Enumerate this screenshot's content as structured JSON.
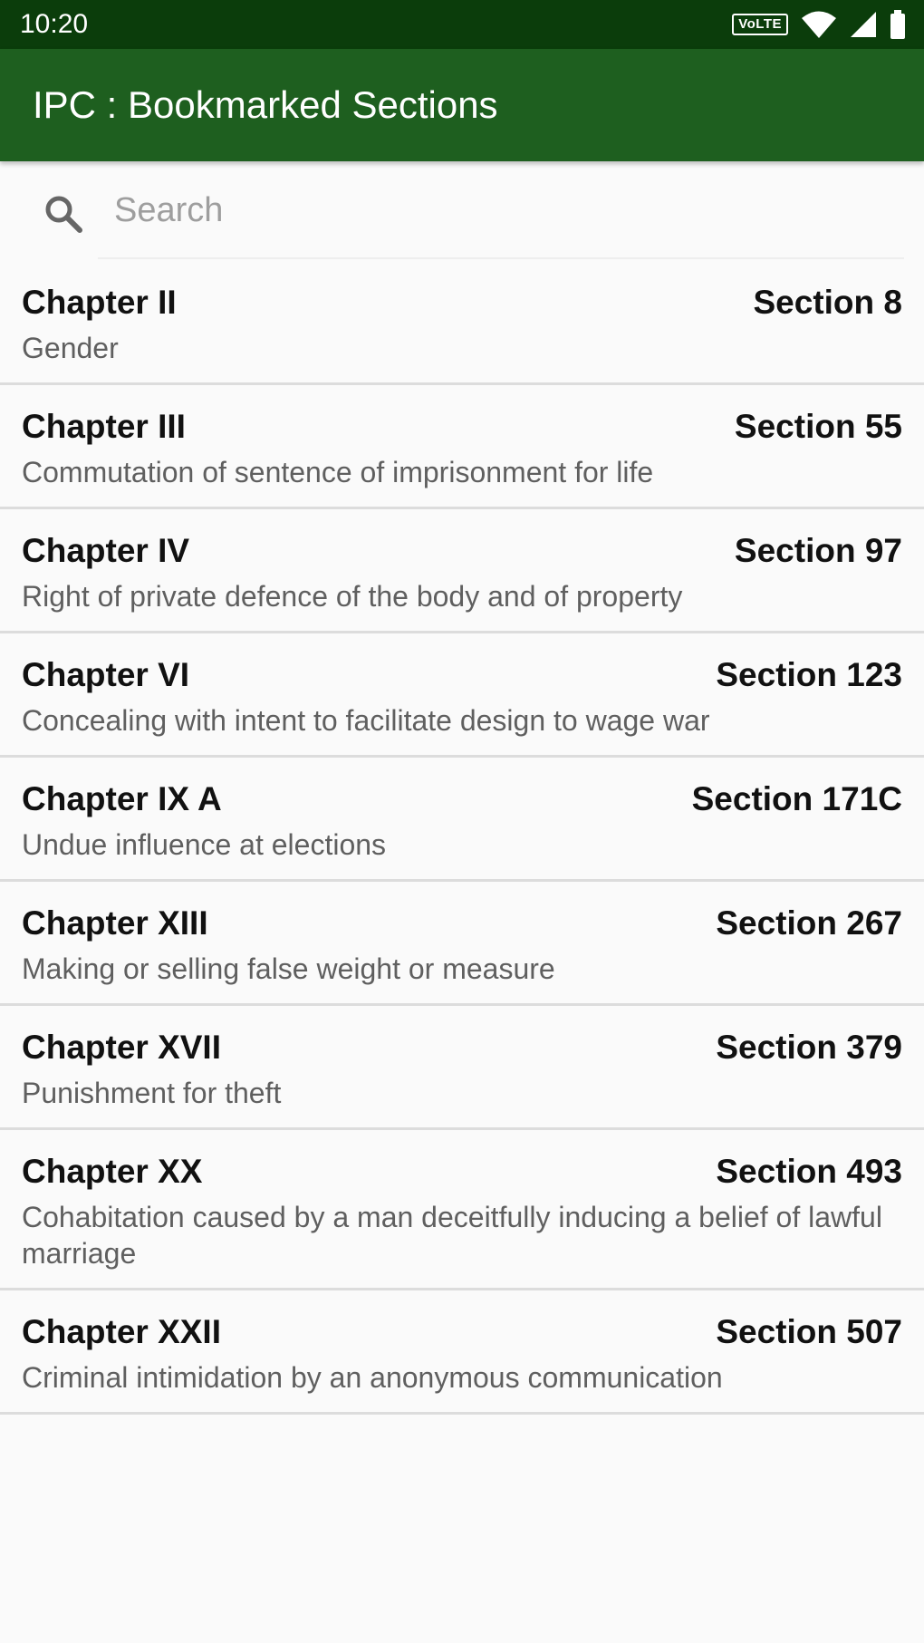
{
  "status_bar": {
    "time": "10:20",
    "volte": "VoLTE",
    "icons": [
      "wifi-icon",
      "signal-icon",
      "battery-icon"
    ]
  },
  "app_bar": {
    "title": "IPC : Bookmarked Sections",
    "color": "#1e5f1f"
  },
  "search": {
    "placeholder": "Search",
    "value": ""
  },
  "items": [
    {
      "chapter": "Chapter II",
      "section": "Section 8",
      "title": "Gender"
    },
    {
      "chapter": "Chapter III",
      "section": "Section 55",
      "title": "Commutation of sentence of imprisonment for life"
    },
    {
      "chapter": "Chapter IV",
      "section": "Section 97",
      "title": "Right of private defence of the body and of property"
    },
    {
      "chapter": "Chapter VI",
      "section": "Section 123",
      "title": "Concealing with intent to facilitate design to wage war"
    },
    {
      "chapter": "Chapter IX A",
      "section": "Section 171C",
      "title": "Undue influence at elections"
    },
    {
      "chapter": "Chapter XIII",
      "section": "Section 267",
      "title": "Making or selling false weight or measure"
    },
    {
      "chapter": "Chapter XVII",
      "section": "Section 379",
      "title": "Punishment for theft"
    },
    {
      "chapter": "Chapter XX",
      "section": "Section 493",
      "title": "Cohabitation caused by a man deceitfully inducing a belief of lawful marriage"
    },
    {
      "chapter": "Chapter XXII",
      "section": "Section 507",
      "title": "Criminal intimidation by an anonymous communication"
    }
  ]
}
